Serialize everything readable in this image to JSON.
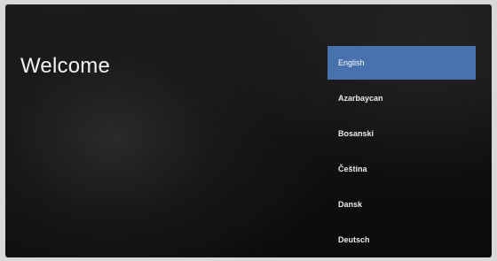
{
  "screen": {
    "title": "Welcome"
  },
  "languages": {
    "selected_index": 0,
    "items": [
      {
        "label": "English"
      },
      {
        "label": "Azarbaycan"
      },
      {
        "label": "Bosanski"
      },
      {
        "label": "Čeština"
      },
      {
        "label": "Dansk"
      },
      {
        "label": "Deutsch"
      }
    ]
  },
  "colors": {
    "selection_highlight": "#4772ad",
    "background": "#121212"
  }
}
